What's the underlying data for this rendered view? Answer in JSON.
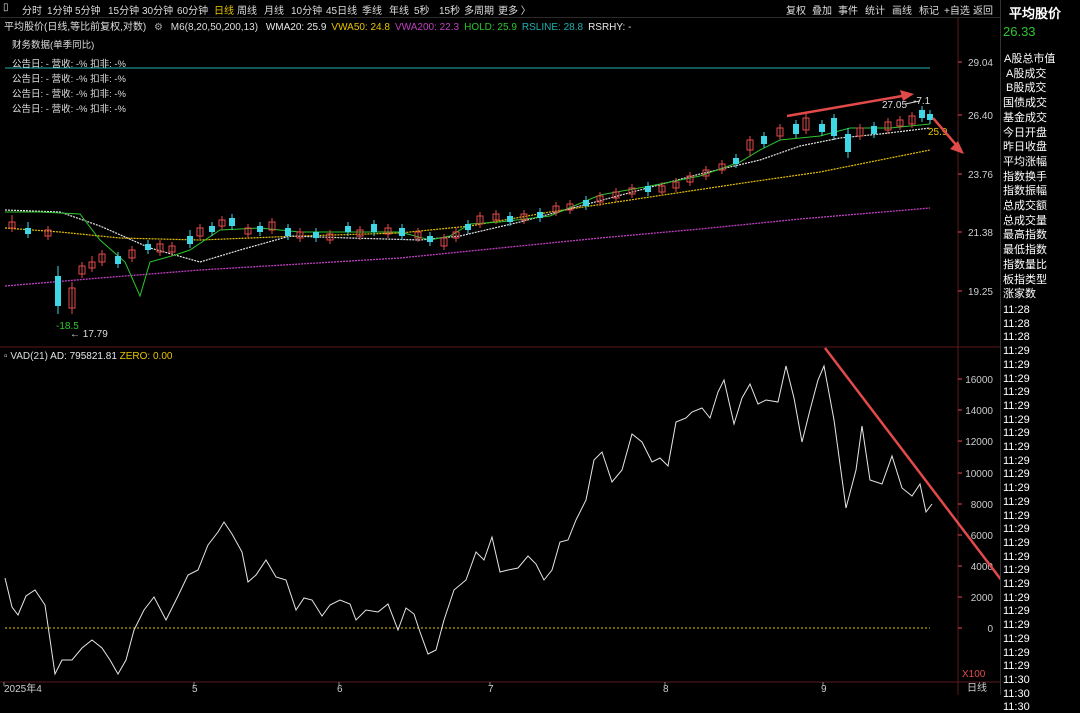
{
  "toolbar": {
    "periods": [
      "分时",
      "1分钟",
      "5分钟",
      "15分钟",
      "30分钟",
      "60分钟",
      "日线",
      "周线",
      "月线",
      "10分钟",
      "45日线",
      "季线",
      "年线",
      "5秒",
      "15秒",
      "多周期",
      "更多 〉"
    ],
    "active_period": "日线",
    "tools": [
      "复权",
      "叠加",
      "事件",
      "统计",
      "画线",
      "标记",
      "+自选",
      "返回"
    ]
  },
  "main_chart": {
    "security_name": "平均股价(日线,等比前复权,对数)",
    "indicator_params": "M6(8,20,50,200,13)",
    "indicators": [
      {
        "label": "WMA20: 25.9",
        "color": "#e6e6e6"
      },
      {
        "label": "VWA50: 24.8",
        "color": "#e8c400"
      },
      {
        "label": "VWA200: 22.3",
        "color": "#c040c0"
      },
      {
        "label": "HOLD: 25.9",
        "color": "#2ec52e"
      },
      {
        "label": "RSLINE: 28.8",
        "color": "#20b0b0"
      },
      {
        "label": "RSRHY: -",
        "color": "#e6e6e6"
      }
    ],
    "financial_header": "财务数据(单季同比)",
    "financial_rows": [
      "公告日: -   营收: -%   扣非: -%",
      "公告日: -   营收: -%   扣非: -%",
      "公告日: -   营收: -%   扣非: -%",
      "公告日: -   营收: -%   扣非: -%"
    ],
    "price_axis": [
      "29.04",
      "26.40",
      "23.76",
      "21.38",
      "19.25"
    ],
    "annotations": {
      "high_label": "27.05",
      "high_suffix": "-7.1",
      "low_label": "17.79",
      "low_value_label": "-18.5",
      "last_label": "25.9"
    }
  },
  "sub_chart": {
    "indicator": "VAD(21)",
    "ad_label": "AD: 795821.81",
    "zero_label": "ZERO: 0.00",
    "axis": [
      "16000",
      "14000",
      "12000",
      "10000",
      "8000",
      "6000",
      "4000",
      "2000",
      "0"
    ],
    "scale_label": "X100"
  },
  "x_axis": {
    "labels": [
      "2025年4",
      "5",
      "6",
      "7",
      "8",
      "9"
    ],
    "period_label": "日线"
  },
  "right_panel": {
    "title": "平均股价",
    "price": "26.33",
    "items": [
      "A股总市值",
      "A股成交",
      "B股成交",
      "国债成交",
      "基金成交",
      "今日开盘",
      "昨日收盘",
      "平均涨幅",
      "指数换手",
      "指数振幅",
      "总成交额",
      "总成交量",
      "最高指数",
      "最低指数",
      "指数量比",
      "板指类型",
      "涨家数"
    ],
    "times": [
      "11:28",
      "11:28",
      "11:28",
      "11:29",
      "11:29",
      "11:29",
      "11:29",
      "11:29",
      "11:29",
      "11:29",
      "11:29",
      "11:29",
      "11:29",
      "11:29",
      "11:29",
      "11:29",
      "11:29",
      "11:29",
      "11:29",
      "11:29",
      "11:29",
      "11:29",
      "11:29",
      "11:29",
      "11:29",
      "11:29",
      "11:29",
      "11:30",
      "11:30",
      "11:30"
    ]
  }
}
